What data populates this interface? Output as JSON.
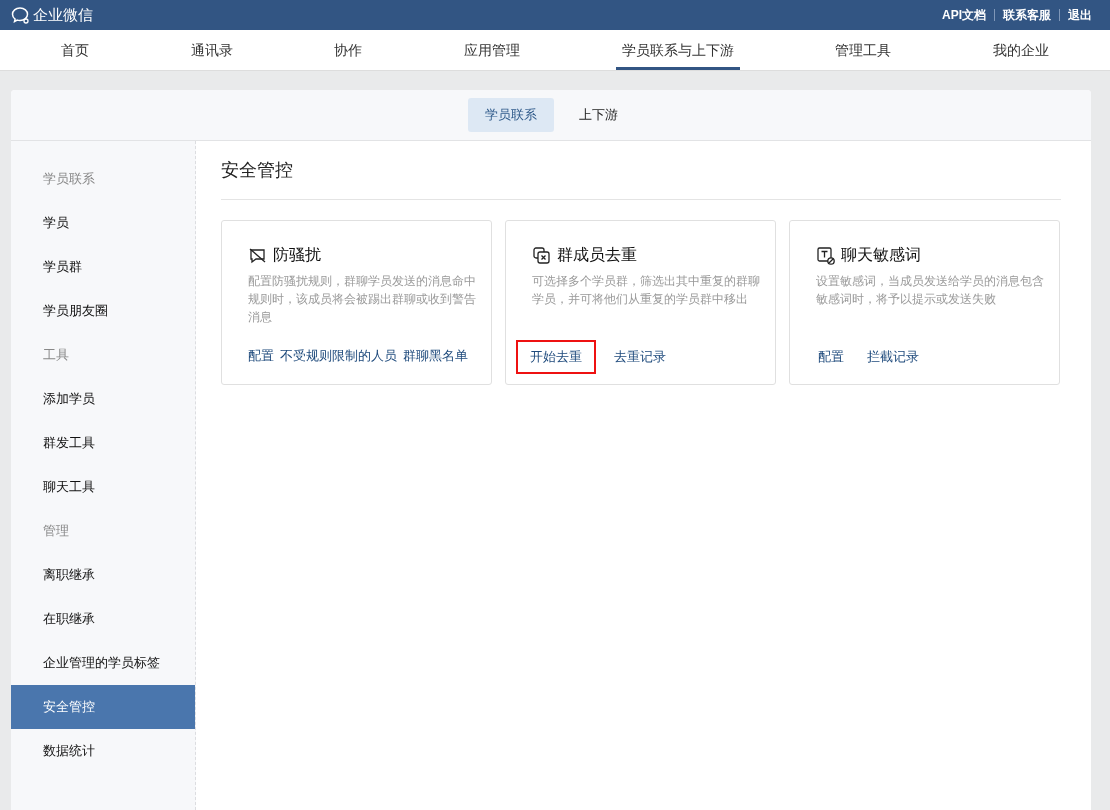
{
  "topbar": {
    "logo": "企业微信",
    "links": [
      "API文档",
      "联系客服",
      "退出"
    ]
  },
  "nav": [
    {
      "label": "首页",
      "selected": false
    },
    {
      "label": "通讯录",
      "selected": false
    },
    {
      "label": "协作",
      "selected": false
    },
    {
      "label": "应用管理",
      "selected": false
    },
    {
      "label": "学员联系与上下游",
      "selected": true
    },
    {
      "label": "管理工具",
      "selected": false
    },
    {
      "label": "我的企业",
      "selected": false
    }
  ],
  "subtabs": [
    {
      "label": "学员联系",
      "selected": true
    },
    {
      "label": "上下游",
      "selected": false
    }
  ],
  "sidebar": {
    "groups": [
      {
        "title": "学员联系",
        "items": [
          {
            "label": "学员",
            "selected": false
          },
          {
            "label": "学员群",
            "selected": false
          },
          {
            "label": "学员朋友圈",
            "selected": false
          }
        ]
      },
      {
        "title": "工具",
        "items": [
          {
            "label": "添加学员",
            "selected": false
          },
          {
            "label": "群发工具",
            "selected": false
          },
          {
            "label": "聊天工具",
            "selected": false
          }
        ]
      },
      {
        "title": "管理",
        "items": [
          {
            "label": "离职继承",
            "selected": false
          },
          {
            "label": "在职继承",
            "selected": false
          },
          {
            "label": "企业管理的学员标签",
            "selected": false
          },
          {
            "label": "安全管控",
            "selected": true
          },
          {
            "label": "数据统计",
            "selected": false
          }
        ]
      }
    ]
  },
  "content": {
    "title": "安全管控",
    "cards": [
      {
        "kind": "harass",
        "title": "防骚扰",
        "description": "配置防骚扰规则，群聊学员发送的消息命中规则时，该成员将会被踢出群聊或收到警告消息",
        "links": [
          {
            "label": "配置",
            "highlighted": false
          },
          {
            "label": "不受规则限制的人员",
            "highlighted": false
          },
          {
            "label": "群聊黑名单",
            "highlighted": false
          }
        ]
      },
      {
        "kind": "dedupe",
        "title": "群成员去重",
        "description": "可选择多个学员群，筛选出其中重复的群聊学员，并可将他们从重复的学员群中移出",
        "links": [
          {
            "label": "开始去重",
            "highlighted": true
          },
          {
            "label": "去重记录",
            "highlighted": false
          }
        ]
      },
      {
        "kind": "sensitive",
        "title": "聊天敏感词",
        "description": "设置敏感词，当成员发送给学员的消息包含敏感词时，将予以提示或发送失败",
        "links": [
          {
            "label": "配置",
            "highlighted": false
          },
          {
            "label": "拦截记录",
            "highlighted": false
          }
        ]
      }
    ]
  }
}
